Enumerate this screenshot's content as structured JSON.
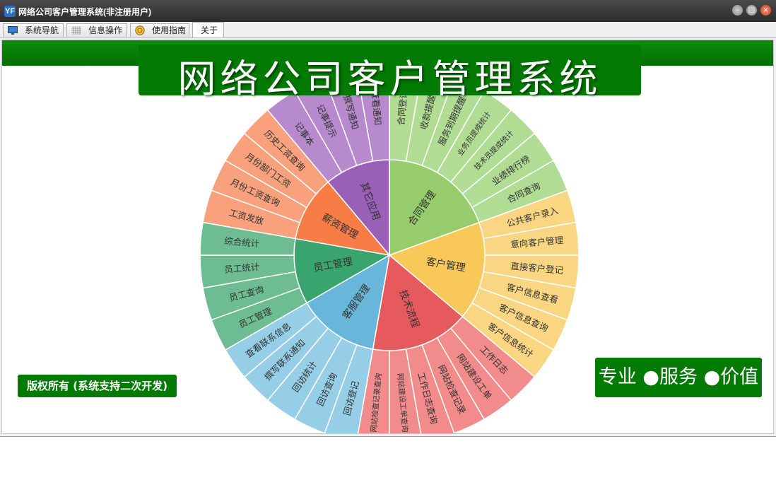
{
  "window": {
    "title": "网络公司客户管理系统(非注册用户)",
    "app_icon": "YF"
  },
  "window_buttons": {
    "minimize": "–",
    "maximize": "□",
    "close": "×"
  },
  "tabs": [
    {
      "label": "系统导航",
      "icon": "monitor-icon"
    },
    {
      "label": "信息操作",
      "icon": "grid-icon"
    },
    {
      "label": "使用指南",
      "icon": "coin-icon"
    },
    {
      "label": "关于",
      "icon": ""
    }
  ],
  "active_tab": 3,
  "header": {
    "title": "网络公司客户管理系统"
  },
  "footer": {
    "copyright": "版权所有 (系统支持二次开发)",
    "slogan": "专业 ●服务 ●价值"
  },
  "colors": {
    "brand_green": "#037a03"
  },
  "menu": [
    {
      "name": "合同管理",
      "color": "#97cc6c",
      "light": "#b0dc94",
      "items": [
        "合同登记",
        "收款提醒",
        "服务到期提醒",
        "业务员提成统计",
        "技术员提成统计",
        "业绩排行榜",
        "合同查询"
      ]
    },
    {
      "name": "客户管理",
      "color": "#f8c858",
      "light": "#fbd682",
      "items": [
        "公共客户录入",
        "意向客户管理",
        "直接客户登记",
        "客户信息查看",
        "客户信息查询",
        "客户信息统计"
      ]
    },
    {
      "name": "技术流程",
      "color": "#e65a5e",
      "light": "#f28b8b",
      "items": [
        "工作日志",
        "网站建设工单",
        "网站检查记录",
        "工作日志查询",
        "网站建设工单查询",
        "网站检查记录查询"
      ]
    },
    {
      "name": "客服管理",
      "color": "#68b6da",
      "light": "#96cee8",
      "items": [
        "回访登记",
        "回访查询",
        "回访统计",
        "撰写联系通知",
        "查看联系信息"
      ]
    },
    {
      "name": "员工管理",
      "color": "#3aa46e",
      "light": "#6ebc92",
      "items": [
        "员工管理",
        "员工查询",
        "员工统计",
        "综合统计"
      ]
    },
    {
      "name": "薪资管理",
      "color": "#f77c45",
      "light": "#f9a07c",
      "items": [
        "工资发放",
        "月份工资查询",
        "月份部门工资",
        "历史工资查询"
      ]
    },
    {
      "name": "其它应用",
      "color": "#9a60b8",
      "light": "#b68acc",
      "items": [
        "记事本",
        "记事提示",
        "撰写通知",
        "查看通知"
      ]
    }
  ]
}
